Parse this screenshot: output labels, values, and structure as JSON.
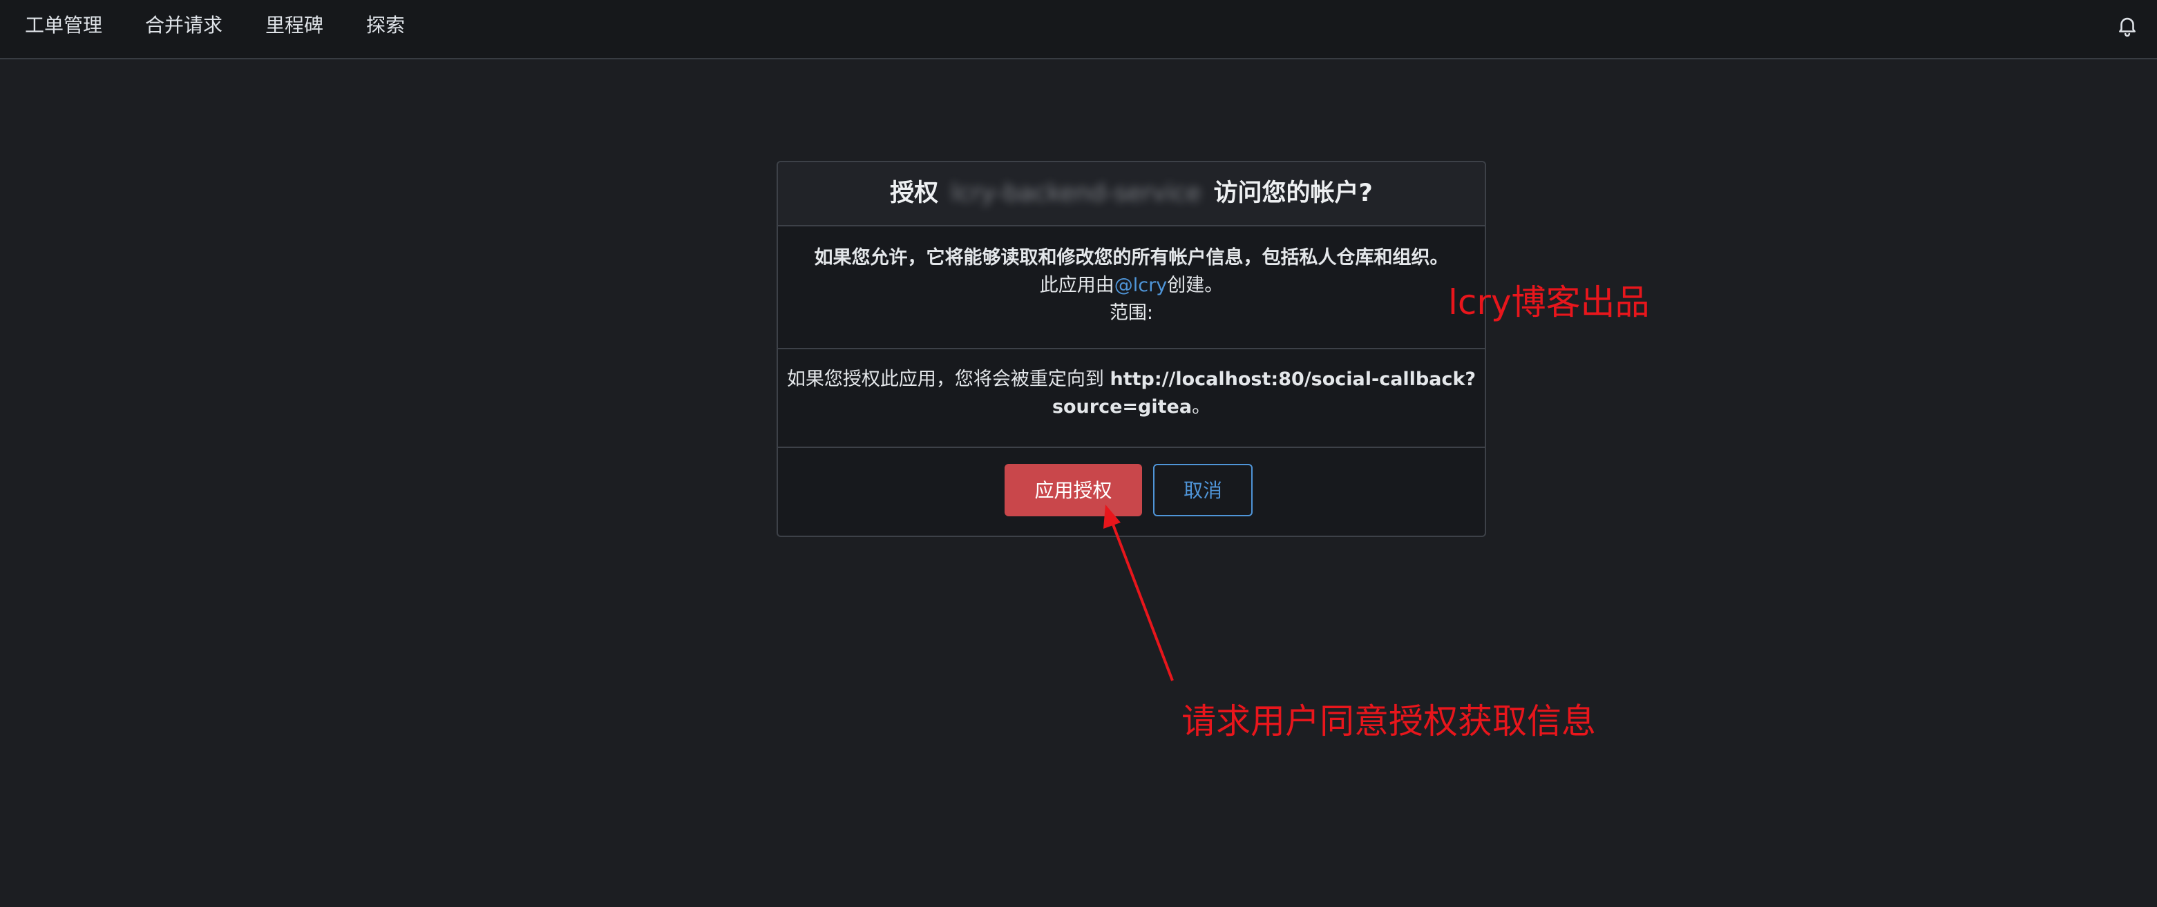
{
  "navbar": {
    "items": [
      "工单管理",
      "合并请求",
      "里程碑",
      "探索"
    ],
    "bell_icon": "bell-icon"
  },
  "dialog": {
    "title_prefix": "授权",
    "app_name": "lcry-backend-service",
    "title_suffix": "访问您的帐户?",
    "warning": "如果您允许，它将能够读取和修改您的所有帐户信息，包括私人仓库和组织。",
    "created_prefix": "此应用由",
    "creator": "@lcry",
    "created_suffix": "创建。",
    "scope_label": "范围:",
    "redirect_prefix": "如果您授权此应用，您将会被重定向到",
    "redirect_url_line1": "http://localhost:80/social-callback?",
    "redirect_url_line2": "source=gitea",
    "redirect_suffix": "。",
    "authorize_button": "应用授权",
    "cancel_button": "取消"
  },
  "annotations": {
    "watermark": "lcry博客出品",
    "note": "请求用户同意授权获取信息",
    "color": "#e8161c"
  },
  "colors": {
    "background": "#1c1e22",
    "primary_button": "#c9474b",
    "link": "#4f95d8"
  }
}
